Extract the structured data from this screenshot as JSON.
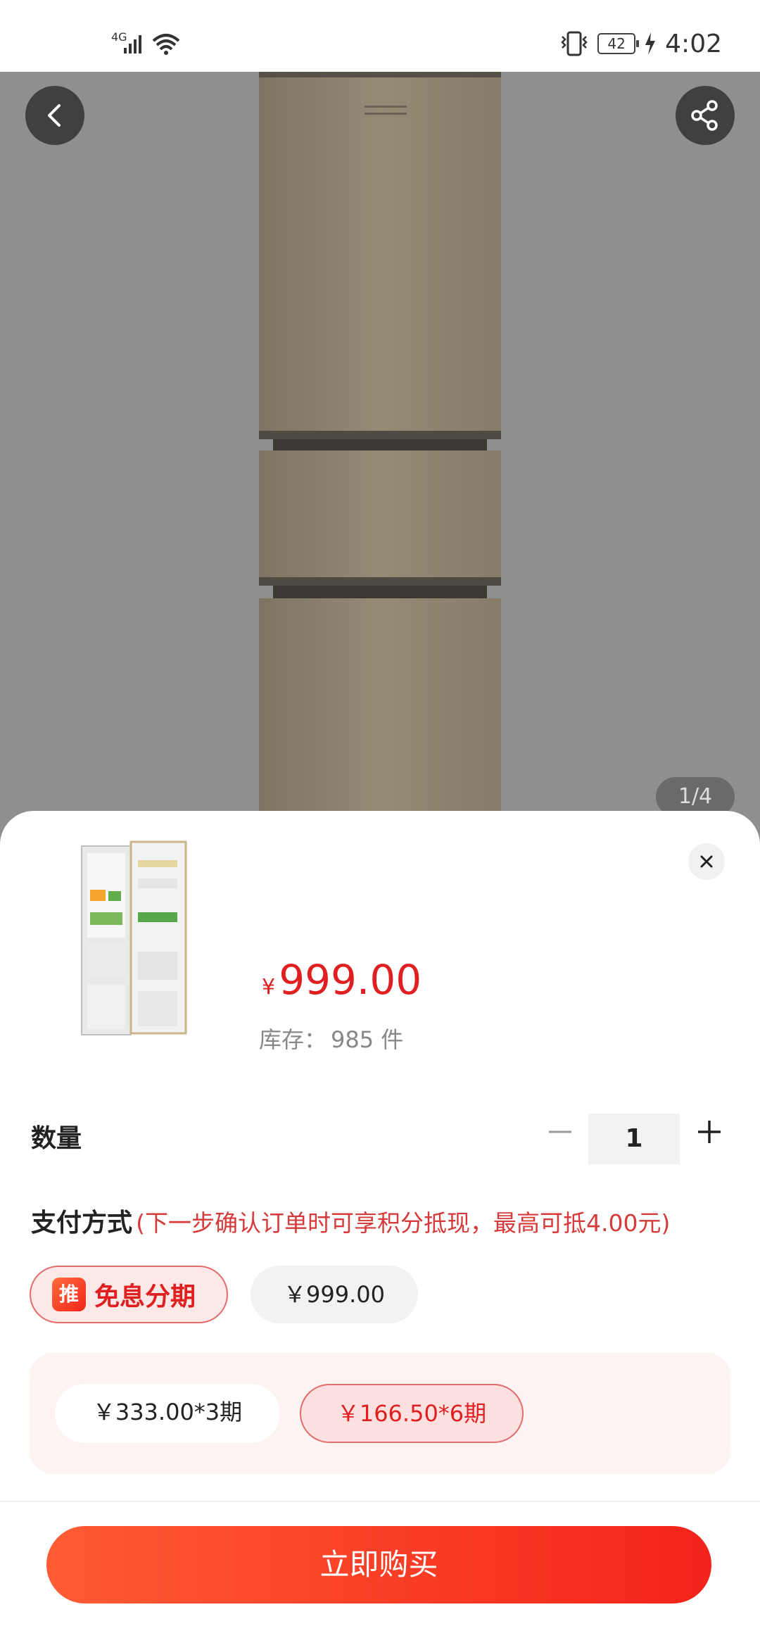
{
  "status_bar": {
    "network": "4G",
    "battery": "42",
    "time": "4:02"
  },
  "gallery": {
    "counter": "1/4"
  },
  "product": {
    "price_symbol": "¥",
    "price": "999.00",
    "stock_label": "库存：",
    "stock_value": "985 件"
  },
  "quantity": {
    "label": "数量",
    "value": "1"
  },
  "payment": {
    "label": "支付方式",
    "note": "(下一步确认订单时可享积分抵现，最高可抵4.00元)",
    "badge": "推",
    "installment_label": "免息分期",
    "full_price_label": "￥999.00",
    "plans": [
      {
        "label": "￥333.00*3期",
        "selected": false
      },
      {
        "label": "￥166.50*6期",
        "selected": true
      }
    ]
  },
  "cta": {
    "buy_label": "立即购买"
  },
  "colors": {
    "accent": "#e02020",
    "cta_start": "#ff5c33",
    "cta_end": "#f3231b",
    "hero_bg": "#8f8f8f"
  }
}
